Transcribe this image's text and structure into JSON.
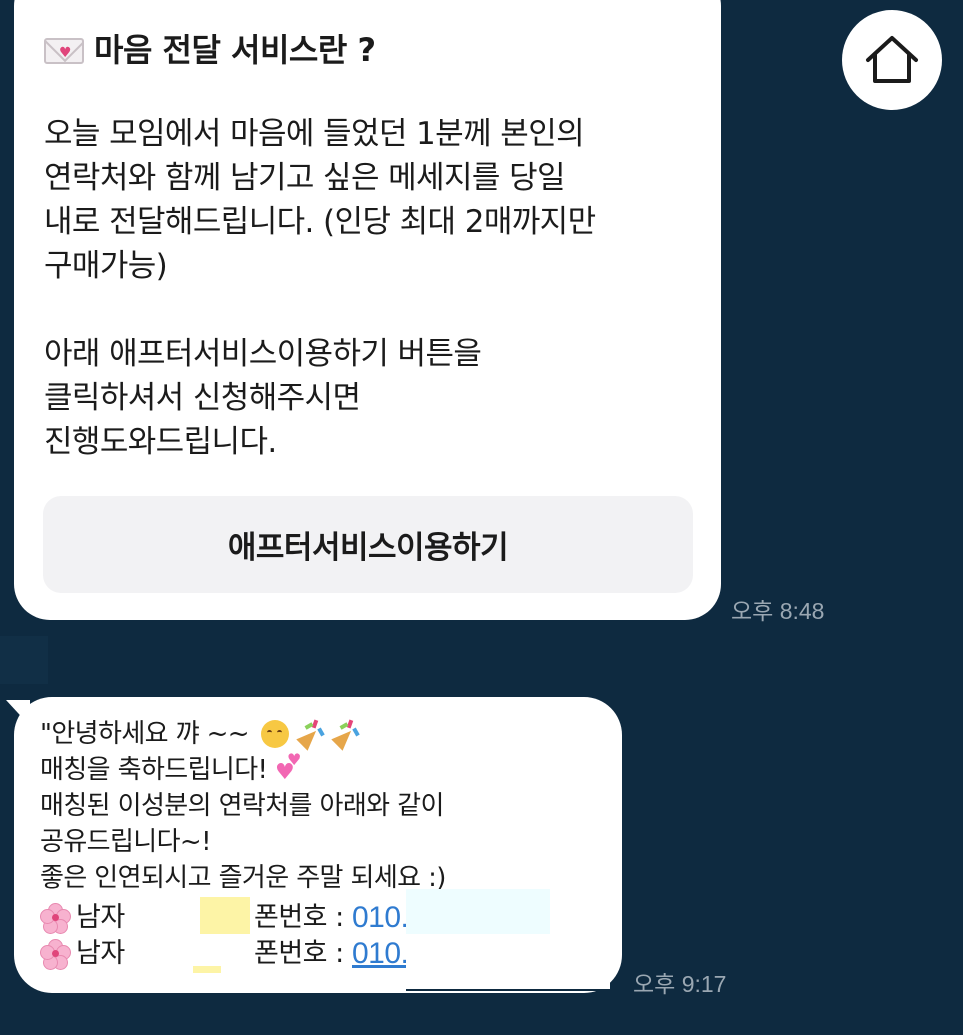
{
  "card_message": {
    "title": "마음 전달 서비스란 ?",
    "title_icon": "love-letter-icon",
    "paragraph1": [
      "오늘 모임에서 마음에 들었던 1분께 본인의",
      "연락처와 함께 남기고 싶은 메세지를 당일",
      "내로 전달해드립니다. (인당 최대 2매까지만",
      "구매가능)"
    ],
    "paragraph2": [
      "아래 애프터서비스이용하기 버튼을",
      "클릭하셔서 신청해주시면",
      "진행도와드립니다."
    ],
    "button_label": "애프터서비스이용하기",
    "time": "오후 8:48"
  },
  "home_button": {
    "icon": "home-icon"
  },
  "match_message": {
    "lines": [
      "\"안녕하세요 꺄 ~~",
      "매칭을 축하드립니다!",
      "매칭된 이성분의 연락처를 아래와 같이",
      "공유드립니다~!",
      "좋은 인연되시고 즐거운 주말 되세요 :)"
    ],
    "contacts": [
      {
        "icon": "cherry-blossom-icon",
        "gender": "남자",
        "phone_label": "폰번호 :",
        "phone": "010."
      },
      {
        "icon": "cherry-blossom-icon",
        "gender": "남자",
        "phone_label": "폰번호 :",
        "phone": "010."
      }
    ],
    "time": "오후 9:17"
  },
  "colors": {
    "background": "#0e2a40",
    "bubble": "#ffffff",
    "button_bg": "#f2f2f4",
    "link": "#2f7bd0",
    "time_text": "#9aa7b2"
  }
}
